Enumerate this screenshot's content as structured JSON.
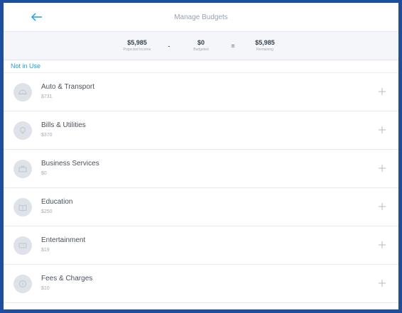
{
  "header": {
    "title": "Manage Budgets",
    "back_icon": "arrow-left-icon"
  },
  "summary": {
    "projected_income": {
      "value": "$5,985",
      "label": "Projected Income"
    },
    "minus": "-",
    "budgeted": {
      "value": "$0",
      "label": "Budgeted"
    },
    "equals": "=",
    "remaining": {
      "value": "$5,985",
      "label": "Remaining"
    }
  },
  "section_label": "Not in Use",
  "categories": [
    {
      "name": "Auto & Transport",
      "amount": "$731",
      "icon": "car-icon"
    },
    {
      "name": "Bills & Utilities",
      "amount": "$370",
      "icon": "lightbulb-icon"
    },
    {
      "name": "Business Services",
      "amount": "$0",
      "icon": "briefcase-icon"
    },
    {
      "name": "Education",
      "amount": "$250",
      "icon": "book-icon"
    },
    {
      "name": "Entertainment",
      "amount": "$19",
      "icon": "ticket-icon"
    },
    {
      "name": "Fees & Charges",
      "amount": "$10",
      "icon": "coin-icon"
    }
  ],
  "colors": {
    "frame": "#1f4f9c",
    "accent": "#1ea1e0",
    "summary_bg": "#f4f6f9"
  }
}
